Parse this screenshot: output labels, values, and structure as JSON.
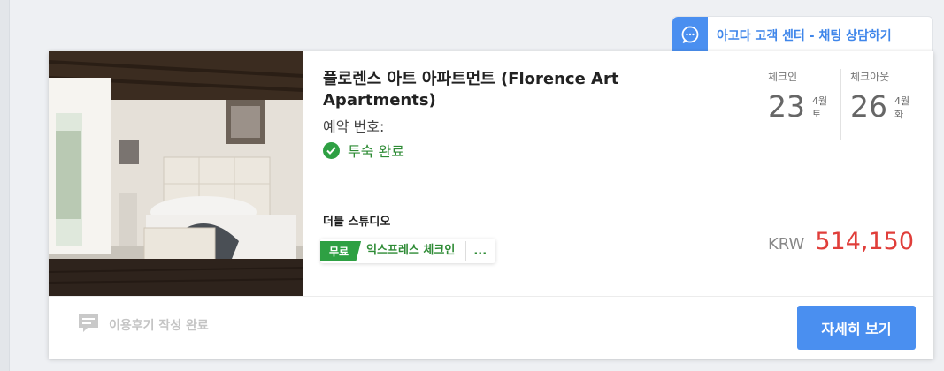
{
  "support": {
    "label": "아고다 고객 센터 - 채팅 상담하기",
    "icon": "chat-bubble-icon"
  },
  "booking": {
    "hotel_name": "플로렌스 아트 아파트먼트 (Florence Art Apartments)",
    "booking_number_label": "예약 번호:",
    "status": "투숙 완료",
    "room_type": "더블 스튜디오",
    "express": {
      "badge": "무료",
      "label": "익스프레스 체크인",
      "more": "..."
    },
    "checkin": {
      "label": "체크인",
      "day": "23",
      "month": "4월",
      "weekday": "토"
    },
    "checkout": {
      "label": "체크아웃",
      "day": "26",
      "month": "4월",
      "weekday": "화"
    },
    "price": {
      "currency": "KRW",
      "amount": "514,150"
    }
  },
  "footer": {
    "review_label": "이용후기 작성 완료",
    "details_button": "자세히 보기"
  },
  "colors": {
    "accent": "#4a8ff0",
    "success": "#2ea043",
    "price": "#e03e3a"
  }
}
